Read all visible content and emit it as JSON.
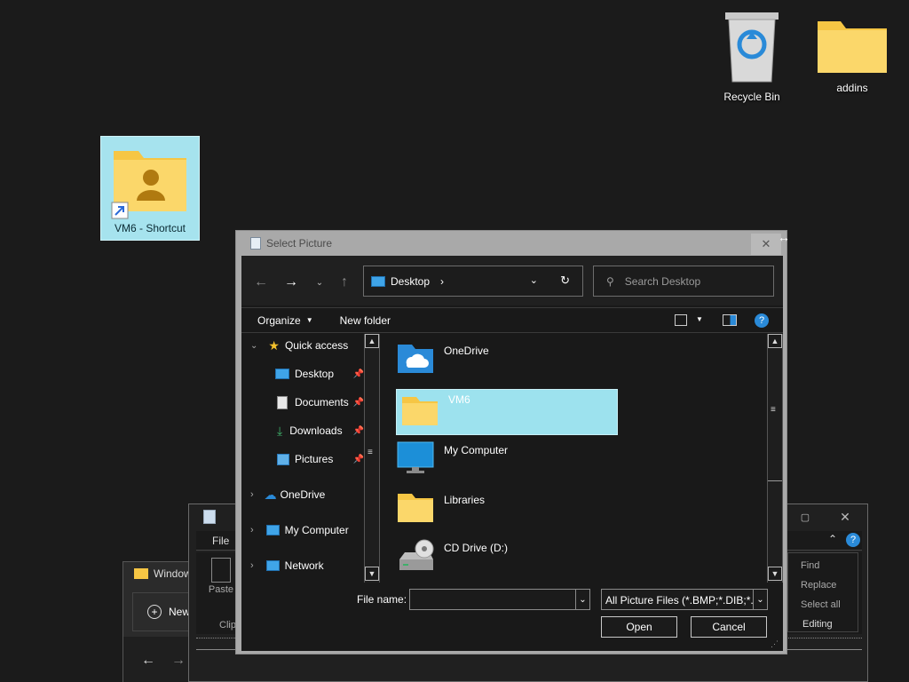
{
  "desktop": {
    "icons": [
      {
        "label": "Recycle Bin"
      },
      {
        "label": "addins"
      },
      {
        "label": "VM6 - Shortcut"
      }
    ]
  },
  "bg_windows": {
    "explorer_title": "Window",
    "explorer_new": "New",
    "wordpad_file": "File",
    "wordpad_paste": "Paste",
    "wordpad_clip": "Clip",
    "wordpad_find": "Find",
    "wordpad_replace": "Replace",
    "wordpad_select_all": "Select all",
    "wordpad_editing": "Editing"
  },
  "dialog": {
    "title": "Select Picture",
    "address": "Desktop",
    "search_placeholder": "Search Desktop",
    "organize": "Organize",
    "new_folder": "New folder",
    "nav": {
      "quick_access": "Quick access",
      "items": [
        "Desktop",
        "Documents",
        "Downloads",
        "Pictures"
      ],
      "onedrive": "OneDrive",
      "my_computer": "My Computer",
      "network": "Network"
    },
    "files": [
      "OneDrive",
      "VM6",
      "My Computer",
      "Libraries",
      "CD Drive (D:)"
    ],
    "file_name_label": "File name:",
    "file_name_value": "",
    "file_type": "All Picture Files (*.BMP;*.DIB;*.F",
    "open": "Open",
    "cancel": "Cancel"
  },
  "colors": {
    "selection": "#9de2ee",
    "folder_yellow": "#f6c644",
    "accent_blue": "#2a8ad8"
  }
}
